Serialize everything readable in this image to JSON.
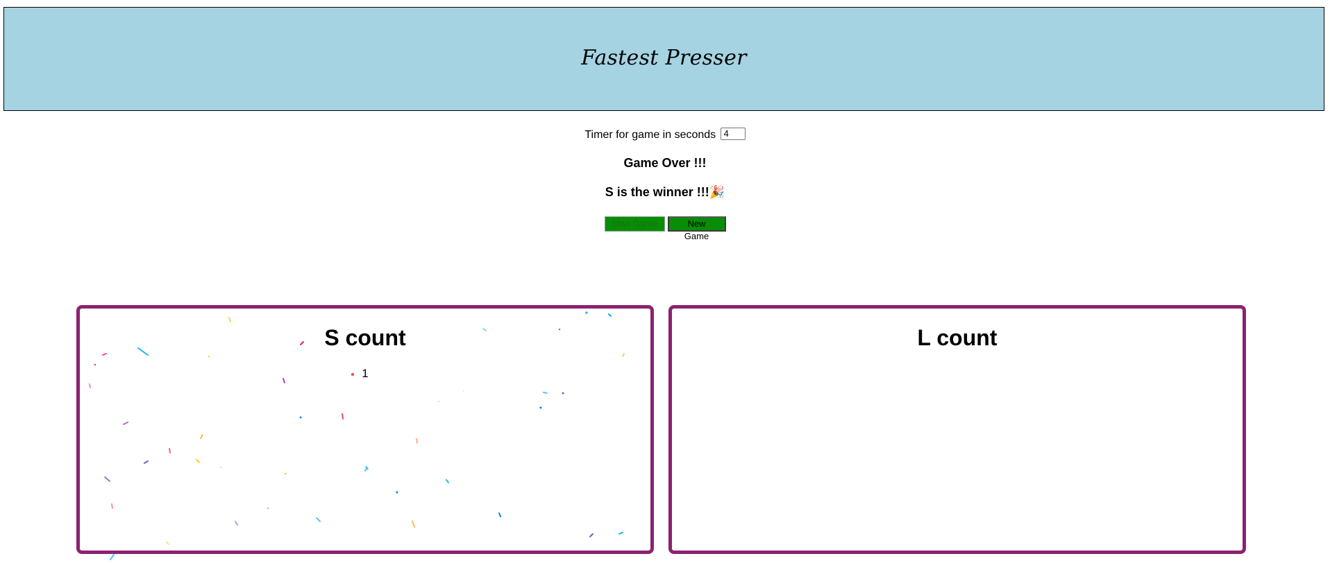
{
  "header": {
    "title": "Fastest Presser"
  },
  "timer": {
    "label": "Timer for game in seconds ",
    "value": "4"
  },
  "status": {
    "game_over": "Game Over !!!",
    "winner": "S is the winner !!!🎉"
  },
  "buttons": {
    "start_label": "Start Game",
    "new_label": "New Game"
  },
  "panels": [
    {
      "title": "S count",
      "count": "1"
    },
    {
      "title": "L count",
      "count": ""
    }
  ],
  "colors": {
    "header_bg": "#a5d3e2",
    "panel_border": "#8b2270",
    "button_bg": "#078e06"
  }
}
